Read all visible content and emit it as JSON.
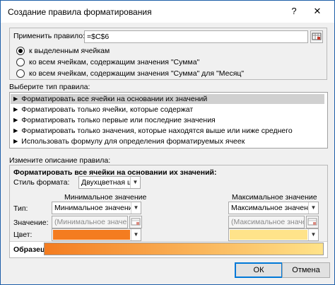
{
  "window": {
    "title": "Создание правила форматирования",
    "help_glyph": "?",
    "close_glyph": "✕"
  },
  "apply_rule": {
    "label": "Применить правило:",
    "value": "=$C$6"
  },
  "radios": [
    {
      "label": "к выделенным ячейкам",
      "checked": true
    },
    {
      "label": "ко всем ячейкам, содержащим значения \"Сумма\"",
      "checked": false
    },
    {
      "label": "ко всем ячейкам, содержащим значения \"Сумма\" для \"Месяц\"",
      "checked": false
    }
  ],
  "rule_type": {
    "header": "Выберите тип правила:",
    "items": [
      "► Форматировать все ячейки на основании их значений",
      "► Форматировать только ячейки, которые содержат",
      "► Форматировать только первые или последние значения",
      "► Форматировать только значения, которые находятся выше или ниже среднего",
      "► Использовать формулу для определения форматируемых ячеек"
    ],
    "selected_index": 0
  },
  "edit": {
    "header": "Измените описание правила:",
    "heading": "Форматировать все ячейки на основании их значений:",
    "style_label": "Стиль формата:",
    "style_value": "Двухцветная шкала",
    "min_header": "Минимальное значение",
    "max_header": "Максимальное значение",
    "type_label": "Тип:",
    "value_label": "Значение:",
    "color_label": "Цвет:",
    "min_type": "Минимальное значение",
    "max_type": "Максимальное значение",
    "min_value": "(Минимальное значение",
    "max_value": "(Максимальное значение",
    "min_color": "#f47c20",
    "max_color": "#ffe38a",
    "preview_label": "Образец:"
  },
  "buttons": {
    "ok": "ОК",
    "cancel": "Отмена"
  }
}
